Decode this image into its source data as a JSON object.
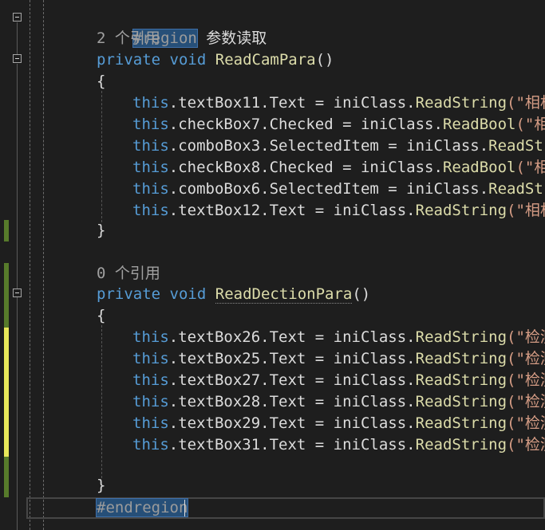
{
  "region": {
    "start": "#region",
    "title": "参数读取",
    "end": "#endregion"
  },
  "methods": [
    {
      "refs": "2 个引用",
      "kw1": "private",
      "kw2": "void",
      "name": "ReadCamPara",
      "parens": "()",
      "open": "{",
      "close": "}",
      "lines": [
        {
          "this": "this",
          "member": ".textBox11.Text = iniClass.",
          "call": "ReadString",
          "str": "(\"相机参"
        },
        {
          "this": "this",
          "member": ".checkBox7.Checked = iniClass.",
          "call": "ReadBool",
          "str": "(\"相机参"
        },
        {
          "this": "this",
          "member": ".comboBox3.SelectedItem = iniClass.",
          "call": "ReadString",
          "str": ""
        },
        {
          "this": "this",
          "member": ".checkBox8.Checked = iniClass.",
          "call": "ReadBool",
          "str": "(\"相机参"
        },
        {
          "this": "this",
          "member": ".comboBox6.SelectedItem = iniClass.",
          "call": "ReadString",
          "str": ""
        },
        {
          "this": "this",
          "member": ".textBox12.Text = iniClass.",
          "call": "ReadString",
          "str": "(\"相机参"
        }
      ]
    },
    {
      "refs": "0 个引用",
      "kw1": "private",
      "kw2": "void",
      "name": "ReadDectionPara",
      "parens": "()",
      "open": "{",
      "close": "}",
      "lines": [
        {
          "this": "this",
          "member": ".textBox26.Text = iniClass.",
          "call": "ReadString",
          "str": "(\"检测参"
        },
        {
          "this": "this",
          "member": ".textBox25.Text = iniClass.",
          "call": "ReadString",
          "str": "(\"检测参"
        },
        {
          "this": "this",
          "member": ".textBox27.Text = iniClass.",
          "call": "ReadString",
          "str": "(\"检测参"
        },
        {
          "this": "this",
          "member": ".textBox28.Text = iniClass.",
          "call": "ReadString",
          "str": "(\"检测参"
        },
        {
          "this": "this",
          "member": ".textBox29.Text = iniClass.",
          "call": "ReadString",
          "str": "(\"检测参"
        },
        {
          "this": "this",
          "member": ".textBox31.Text = iniClass.",
          "call": "ReadString",
          "str": "(\"检测参"
        }
      ]
    }
  ],
  "colors": {
    "keyword": "#569cd6",
    "method": "#dcdcaa",
    "string": "#d69d85",
    "text": "#dcdcdc",
    "reference": "#a0a0a0",
    "changed_saved": "#577b2b",
    "changed_unsaved": "#e8e85a"
  }
}
